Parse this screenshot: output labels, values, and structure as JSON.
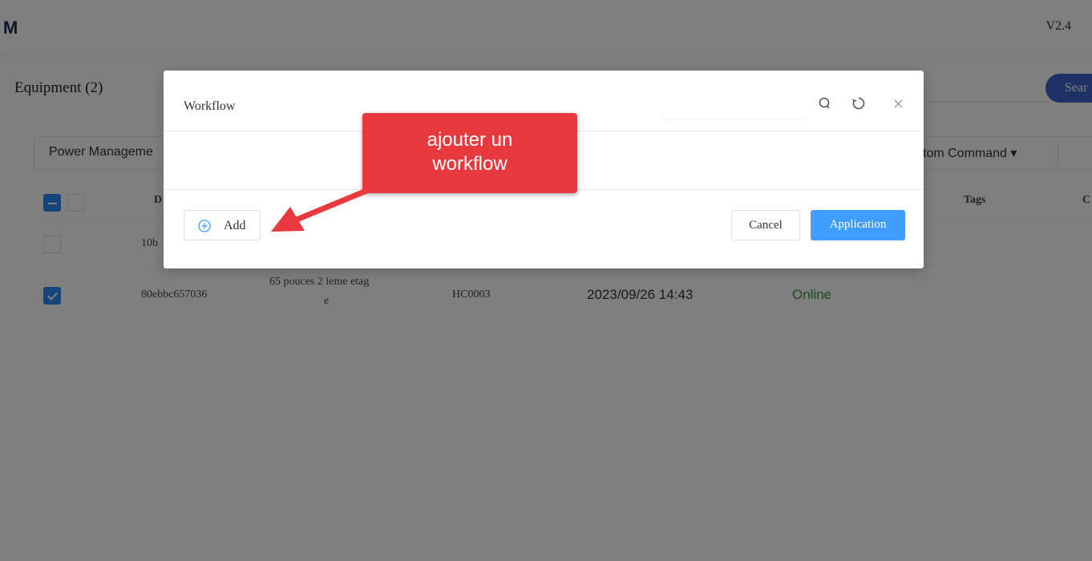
{
  "header": {
    "logo": "M",
    "version": "V2.4"
  },
  "equipment": {
    "title": "Equipment (2)",
    "search_button": "Sear",
    "toolbar": {
      "power_management": "Power Manageme",
      "custom_command": "stom Command ▾"
    },
    "table": {
      "headers": {
        "col_d": "D",
        "tags": "Tags",
        "col_c": "C"
      },
      "rows": [
        {
          "checked": false,
          "id": "10b",
          "name": "",
          "code": "",
          "time": "",
          "status": ""
        },
        {
          "checked": true,
          "id": "80ebbc657036",
          "name_line1": "65 pouces 2 ieme etag",
          "name_line2": "e",
          "code": "HC0003",
          "time": "2023/09/26 14:43",
          "status": "Online"
        }
      ]
    }
  },
  "modal": {
    "title": "Workflow",
    "search_placeholder": "",
    "add_label": "Add",
    "cancel_label": "Cancel",
    "apply_label": "Application"
  },
  "callout": {
    "line1": "ajouter un",
    "line2": "workflow"
  },
  "colors": {
    "primary": "#409eff",
    "callout": "#e8393e",
    "online": "#2e9e3e",
    "search_btn": "#3a63c8"
  }
}
